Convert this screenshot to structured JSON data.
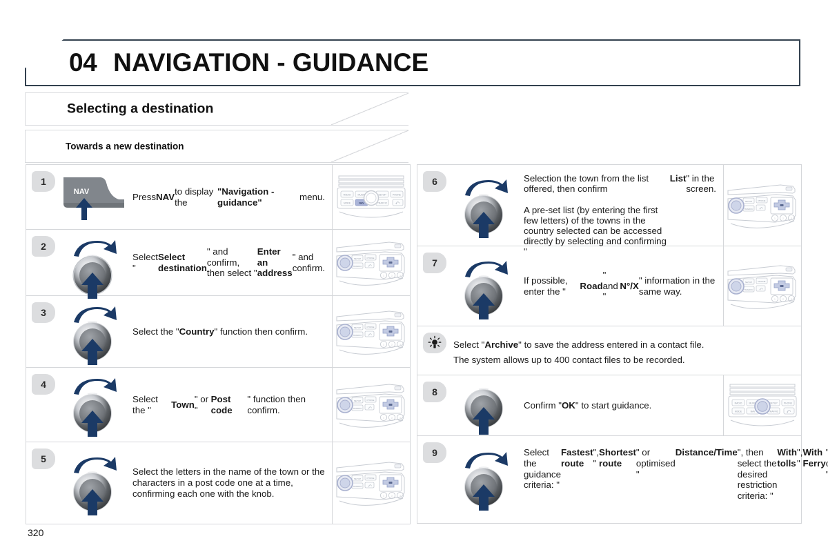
{
  "header": {
    "chapter_number": "04",
    "chapter_title": "NAVIGATION - GUIDANCE",
    "accent_color": "#33414f"
  },
  "sections": [
    {
      "label": "Selecting a destination"
    },
    {
      "label": "Towards a new destination"
    }
  ],
  "left_steps": [
    {
      "number": "1",
      "icon": "nav-button-icon",
      "icon_label": "NAV",
      "panel": "radio-panel-front-nav-highlighted",
      "text_html": "Press <b>NAV</b> to display the <b>\"Navigation - guidance\"</b> menu."
    },
    {
      "number": "2",
      "icon": "rotary-knob-icon",
      "panel": "radio-panel-angled",
      "text_html": "Select \"<b>Select destination</b>\" and confirm, then select \"<b>Enter an address</b>\" and confirm."
    },
    {
      "number": "3",
      "icon": "rotary-knob-icon",
      "panel": "radio-panel-angled",
      "text_html": "Select the \"<b>Country</b>\" function then confirm."
    },
    {
      "number": "4",
      "icon": "rotary-knob-icon",
      "panel": "radio-panel-angled",
      "text_html": "Select the \"<b>Town</b>\" or \"<b>Post code</b>\" function then confirm."
    },
    {
      "number": "5",
      "icon": "rotary-knob-icon",
      "panel": "radio-panel-angled",
      "text_html": "Select the letters in the name of the town or the characters in a post code one at a time, confirming each one with the knob."
    }
  ],
  "right_steps": [
    {
      "number": "6",
      "icon": "rotary-knob-icon",
      "panel": "radio-panel-angled",
      "text_html": "Selection the town from the list offered, then confirm<br><br>A pre-set list (by entering the first few letters) of the towns in the country selected can be accessed directly by selecting and confirming \"<b>List</b>\" in the screen."
    },
    {
      "number": "7",
      "icon": "rotary-knob-icon",
      "panel": "radio-panel-angled",
      "text_html": "If possible, enter the \"<b>Road</b>\" and \"<b>N°/X</b>\" information in the same way."
    }
  ],
  "tip": {
    "icon": "lightbulb-icon",
    "text_html": "Select \"<b>Archive</b>\" to save the address entered in a contact file.<br>The system allows up to 400 contact files to be recorded."
  },
  "right_steps_2": [
    {
      "number": "8",
      "icon": "rotary-knob-press-icon",
      "panel": "radio-panel-front-knob-highlighted",
      "text_html": "Confirm \"<b>OK</b>\" to start guidance."
    },
    {
      "number": "9",
      "icon": "rotary-knob-icon",
      "panel": "radio-panel-angled",
      "text_html": "Select the guidance criteria: \"<b>Fastest route</b>\", \"<b>Shortest route</b>\" or optimised \"<b>Distance/Time</b>\", then select the desired restriction criteria: \"<b>With tolls</b>\", \"<b>With Ferry</b>\", or \"<b>Traffic info</b>\" then confirm \"<b>OK</b>\"."
    }
  ],
  "footer": {
    "page_number": "320"
  },
  "panel_button_labels": {
    "front_top": [
      "RADIO",
      "MUSIC",
      "SETUP",
      "PHONE"
    ],
    "front_bottom": [
      "MODE",
      "NAV",
      "TRAFFIC",
      "BACK"
    ],
    "angled": [
      "SETUP",
      "PHONE",
      "TRAFFIC",
      "BACK"
    ]
  }
}
